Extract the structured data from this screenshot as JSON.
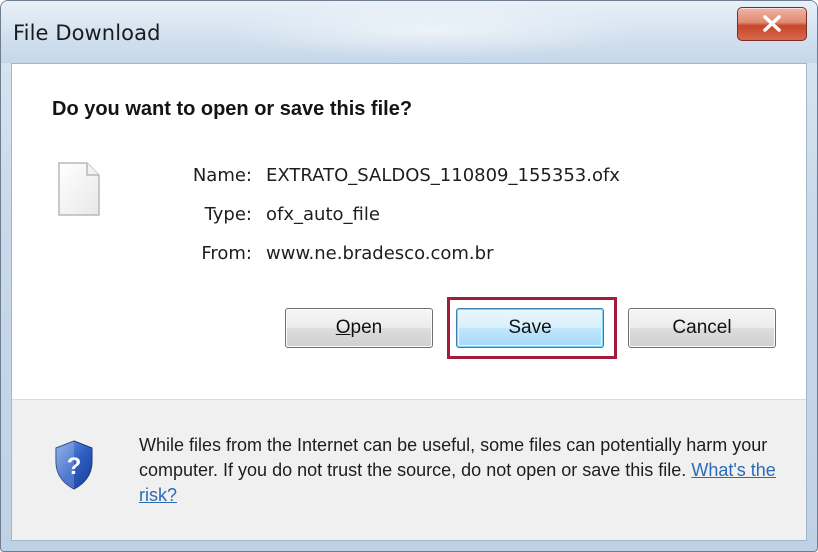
{
  "window": {
    "title": "File Download"
  },
  "dialog": {
    "question": "Do you want to open or save this file?",
    "file": {
      "name_label": "Name:",
      "name_value": "EXTRATO_SALDOS_110809_155353.ofx",
      "type_label": "Type:",
      "type_value": "ofx_auto_file",
      "from_label": "From:",
      "from_value": "www.ne.bradesco.com.br"
    },
    "buttons": {
      "open_accel": "O",
      "open_rest": "pen",
      "save": "Save",
      "cancel": "Cancel"
    },
    "warning": {
      "text": "While files from the Internet can be useful, some files can potentially harm your computer. If you do not trust the source, do not open or save this file.",
      "link": "What's the risk?"
    }
  },
  "icons": {
    "close": "close-icon",
    "file": "file-icon",
    "shield": "shield-question-icon"
  },
  "colors": {
    "highlight": "#a11d3a",
    "link": "#2a6bb4",
    "close_button": "#c7452b"
  }
}
